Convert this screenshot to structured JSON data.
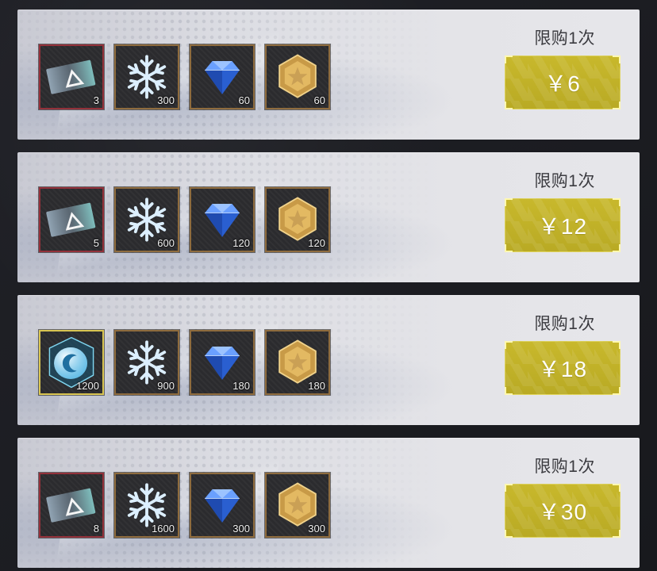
{
  "packs": [
    {
      "limit_text": "限购1次",
      "price": "￥6",
      "items": [
        {
          "icon": "ticket-icon",
          "qty": "3",
          "frame": "red"
        },
        {
          "icon": "snowflake-icon",
          "qty": "300",
          "frame": "bronze"
        },
        {
          "icon": "diamond-icon",
          "qty": "60",
          "frame": "bronze"
        },
        {
          "icon": "gold-star-medal-icon",
          "qty": "60",
          "frame": "bronze"
        }
      ]
    },
    {
      "limit_text": "限购1次",
      "price": "￥12",
      "items": [
        {
          "icon": "ticket-icon",
          "qty": "5",
          "frame": "red"
        },
        {
          "icon": "snowflake-icon",
          "qty": "600",
          "frame": "bronze"
        },
        {
          "icon": "diamond-icon",
          "qty": "120",
          "frame": "bronze"
        },
        {
          "icon": "gold-star-medal-icon",
          "qty": "120",
          "frame": "bronze"
        }
      ]
    },
    {
      "limit_text": "限购1次",
      "price": "￥18",
      "items": [
        {
          "icon": "blue-crystal-orb-icon",
          "qty": "1200",
          "frame": "gold"
        },
        {
          "icon": "snowflake-icon",
          "qty": "900",
          "frame": "bronze"
        },
        {
          "icon": "diamond-icon",
          "qty": "180",
          "frame": "bronze"
        },
        {
          "icon": "gold-star-medal-icon",
          "qty": "180",
          "frame": "bronze"
        }
      ]
    },
    {
      "limit_text": "限购1次",
      "price": "￥30",
      "items": [
        {
          "icon": "ticket-icon",
          "qty": "8",
          "frame": "red"
        },
        {
          "icon": "snowflake-icon",
          "qty": "1600",
          "frame": "bronze"
        },
        {
          "icon": "diamond-icon",
          "qty": "300",
          "frame": "bronze"
        },
        {
          "icon": "gold-star-medal-icon",
          "qty": "300",
          "frame": "bronze"
        }
      ]
    }
  ],
  "colors": {
    "price_button": "#c2b229",
    "red_frame": "#93313a",
    "bronze_frame": "#8f6c3e",
    "gold_frame": "#d9c552"
  }
}
